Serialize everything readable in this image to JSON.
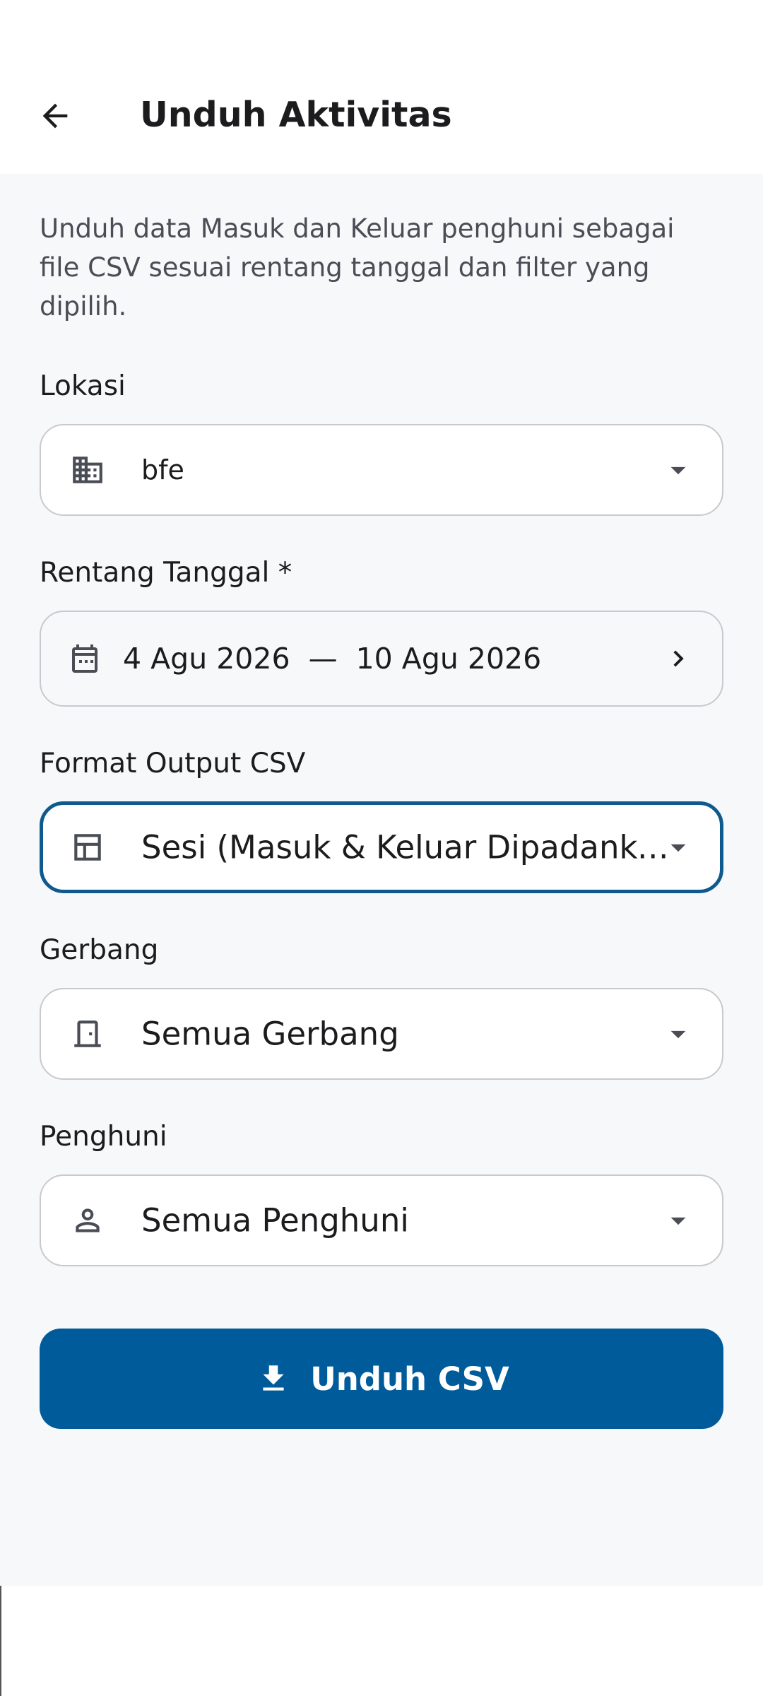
{
  "header": {
    "title": "Unduh Aktivitas",
    "back_icon": "arrow-left-icon"
  },
  "description": "Unduh data Masuk dan Keluar penghuni sebagai file CSV sesuai rentang tanggal dan filter yang dipilih.",
  "fields": {
    "location": {
      "label": "Lokasi",
      "value": "bfe",
      "icon": "building-icon"
    },
    "date_range": {
      "label": "Rentang Tanggal *",
      "start": "4 Agu 2026",
      "separator": "—",
      "end": "10 Agu 2026",
      "icon": "calendar-icon"
    },
    "format": {
      "label": "Format Output CSV",
      "value": "Sesi (Masuk & Keluar Dipadankan)",
      "icon": "table-icon"
    },
    "gate": {
      "label": "Gerbang",
      "value": "Semua Gerbang",
      "icon": "door-icon"
    },
    "resident": {
      "label": "Penghuni",
      "value": "Semua Penghuni",
      "icon": "person-icon"
    }
  },
  "download_button": {
    "label": "Unduh CSV",
    "icon": "download-icon"
  },
  "colors": {
    "primary": "#005b9a",
    "focus_border": "#0e5a8e",
    "background": "#f7f8fa"
  }
}
